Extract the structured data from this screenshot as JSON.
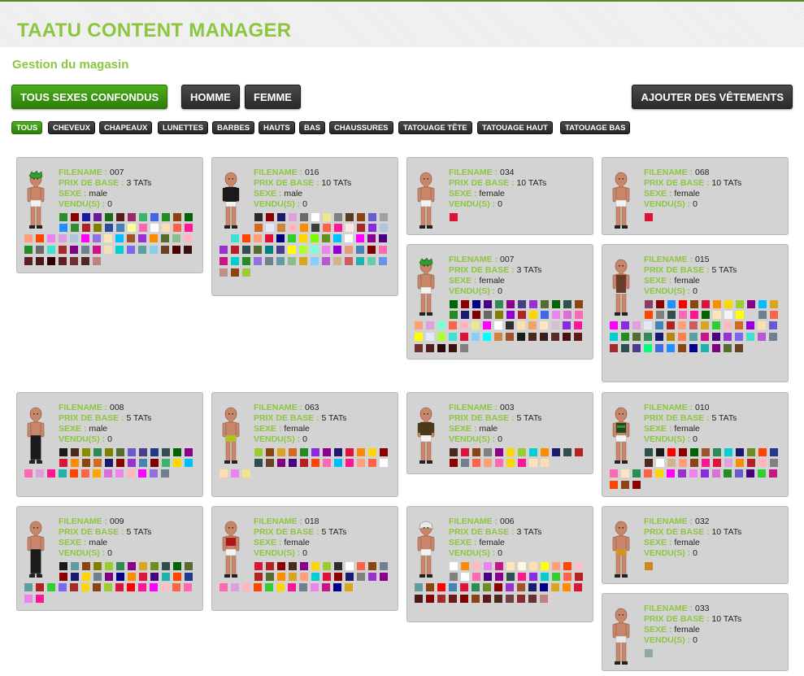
{
  "app_title": "TAATU CONTENT MANAGER",
  "page_subtitle": "Gestion du magasin",
  "gender_filters": [
    {
      "label": "TOUS SEXES CONFONDUS",
      "active": true
    },
    {
      "label": "HOMME",
      "active": false
    },
    {
      "label": "FEMME",
      "active": false
    }
  ],
  "add_button_label": "AJOUTER DES VÊTEMENTS",
  "category_filters": [
    {
      "label": "TOUS",
      "active": true
    },
    {
      "label": "CHEVEUX",
      "active": false
    },
    {
      "label": "CHAPEAUX",
      "active": false
    },
    {
      "label": "LUNETTES",
      "active": false
    },
    {
      "label": "BARBES",
      "active": false
    },
    {
      "label": "HAUTS",
      "active": false
    },
    {
      "label": "BAS",
      "active": false
    },
    {
      "label": "CHAUSSURES",
      "active": false
    },
    {
      "label": "TATOUAGE TÊTE",
      "active": false
    },
    {
      "label": "TATOUAGE HAUT",
      "active": false
    },
    {
      "label": "TATOUAGE BAS",
      "active": false
    }
  ],
  "field_labels": {
    "filename": "FILENAME :",
    "price": "PRIX DE BASE :",
    "sex": "SEXE :",
    "sold": "VENDU(S) :"
  },
  "items": [
    {
      "filename": "007",
      "price": "3 TATs",
      "sex": "male",
      "sold": "0",
      "outfit": "green-hair-shorts"
    },
    {
      "filename": "016",
      "price": "10 TATs",
      "sex": "male",
      "sold": "0",
      "outfit": "black-top"
    },
    {
      "filename": "034",
      "price": "10 TATs",
      "sex": "female",
      "sold": "0",
      "outfit": "plain"
    },
    {
      "filename": "068",
      "price": "10 TATs",
      "sex": "female",
      "sold": "0",
      "outfit": "plain"
    },
    {
      "filename": "007",
      "price": "3 TATs",
      "sex": "female",
      "sold": "0",
      "outfit": "green-hair"
    },
    {
      "filename": "015",
      "price": "5 TATs",
      "sex": "female",
      "sold": "0",
      "outfit": "dress"
    },
    {
      "filename": "008",
      "price": "5 TATs",
      "sex": "male",
      "sold": "0",
      "outfit": "black-pants"
    },
    {
      "filename": "063",
      "price": "5 TATs",
      "sex": "female",
      "sold": "0",
      "outfit": "yellow-bottom"
    },
    {
      "filename": "003",
      "price": "5 TATs",
      "sex": "male",
      "sold": "0",
      "outfit": "brown-top"
    },
    {
      "filename": "010",
      "price": "5 TATs",
      "sex": "female",
      "sold": "0",
      "outfit": "green-top"
    },
    {
      "filename": "009",
      "price": "5 TATs",
      "sex": "male",
      "sold": "0",
      "outfit": "black-pants"
    },
    {
      "filename": "018",
      "price": "5 TATs",
      "sex": "female",
      "sold": "0",
      "outfit": "red-top"
    },
    {
      "filename": "006",
      "price": "3 TATs",
      "sex": "female",
      "sold": "0",
      "outfit": "white-hair"
    },
    {
      "filename": "032",
      "price": "10 TATs",
      "sex": "female",
      "sold": "0",
      "outfit": "orange-bottom"
    },
    {
      "filename": "033",
      "price": "10 TATs",
      "sex": "female",
      "sold": "0",
      "outfit": "white-bottom"
    }
  ],
  "item_colors": [
    [
      "#2e8b2e",
      "#8b0000",
      "#1a1aa0",
      "#6a1a9a",
      "#1a6a1a",
      "#5a1a1a",
      "#9b2a6a",
      "#3cb371",
      "#4169e1",
      "#228b22",
      "#8b4513",
      "#006400",
      "#1e90ff",
      "#2f8f2f",
      "#b22222",
      "#808000",
      "#2e4a9a",
      "#4682b4",
      "#ffff99",
      "#ff69b4",
      "#ffffff",
      "#ffdead",
      "#ff6347",
      "#ff1493",
      "#ffa07a",
      "#ff4500",
      "#ee82ee",
      "#dda0dd",
      "#b0c4de",
      "#ff00ff",
      "#9370db",
      "#ffe4b5",
      "#00bfff",
      "#a0522d",
      "#9932cc",
      "#ff8c00",
      "#556b2f",
      "#8fbc8f",
      "#ffb6c1",
      "#228b22",
      "#696969",
      "#40e0d0",
      "#a52a2a",
      "#800080",
      "#708090",
      "#c71585",
      "#f5deb3",
      "#00ced1",
      "#7b68ee",
      "#5f9ea0",
      "#87ceeb",
      "#6b4226",
      "#4b0000",
      "#3b1010",
      "#5a2020",
      "#4a1a1a",
      "#2a0000",
      "#602020",
      "#703030",
      "#502828",
      "#c08080"
    ],
    [
      "#2a2a2a",
      "#8b0000",
      "#1c1c6e",
      "#dda0dd",
      "#696969",
      "#ffffff",
      "#f0e68c",
      "#808080",
      "#5a3a1a",
      "#8b4513",
      "#6a5acd",
      "#a0a0a0",
      "#d2691e",
      "#e6e6fa",
      "#cd853f",
      "#ffb6c1",
      "#ff8c00",
      "#3c3c3c",
      "#ff6347",
      "#ff1493",
      "#ffe4e1",
      "#a52a2a",
      "#8a2be2",
      "#b0c4de",
      "#d3d3d3",
      "#40e0d0",
      "#ff4500",
      "#ffa07a",
      "#dc143c",
      "#000080",
      "#32cd32",
      "#ffd700",
      "#7cfc00",
      "#6b8e23",
      "#00bfff",
      "#ffffff",
      "#ff00ff",
      "#8b008b",
      "#4b0082",
      "#9932cc",
      "#b22222",
      "#2f4f4f",
      "#556b2f",
      "#008080",
      "#483d8b",
      "#ffff00",
      "#adff2f",
      "#7fffd4",
      "#ee82ee",
      "#9400d3",
      "#e9967a",
      "#4682b4",
      "#800000",
      "#ff69b4",
      "#c71585",
      "#00ced1",
      "#228b22",
      "#9370db",
      "#708090",
      "#5f9ea0",
      "#8fbc8f",
      "#daa520",
      "#87cefa",
      "#ba55d3",
      "#d2b48c",
      "#cd5c5c",
      "#20b2aa",
      "#66cdaa",
      "#6495ed",
      "#bc8f8f",
      "#8b4513",
      "#9acd32"
    ],
    [
      "#dc143c"
    ],
    [
      "#dc143c"
    ],
    [
      "#006400",
      "#8b0000",
      "#00008b",
      "#4b0082",
      "#2e8b57",
      "#8b008b",
      "#483d8b",
      "#9932cc",
      "#556b2f",
      "#006400",
      "#2f4f4f",
      "#8b4513",
      "#228b22",
      "#191970",
      "#800000",
      "#696969",
      "#808000",
      "#9400d3",
      "#b22222",
      "#ffd700",
      "#4169e1",
      "#ee82ee",
      "#da70d6",
      "#ff69b4",
      "#ffa07a",
      "#dda0dd",
      "#7fffd4",
      "#ff6347",
      "#ffb6c1",
      "#f0e68c",
      "#ff00ff",
      "#ffffff",
      "#2e2e2e",
      "#ffdead",
      "#f4a460",
      "#ffe4c4",
      "#d8bfd8",
      "#8a2be2",
      "#ff1493",
      "#ffff00",
      "#e6e6fa",
      "#adff2f",
      "#40e0d0",
      "#dc143c",
      "#87cefa",
      "#00ffff",
      "#cd853f",
      "#a0522d",
      "#1c1c1c",
      "#4a2a1a",
      "#3a1a1a",
      "#5a2a2a",
      "#4a1010",
      "#601818",
      "#703030",
      "#502020",
      "#2a0a0a",
      "#401010",
      "#808080"
    ],
    [
      "#8b3a62",
      "#8b0000",
      "#1e90ff",
      "#ff0000",
      "#8b4513",
      "#dc143c",
      "#ff8c00",
      "#ffd700",
      "#9acd32",
      "#8b008b",
      "#00bfff",
      "#daa520",
      "#ff4500",
      "#808080",
      "#2f4f4f",
      "#ff69b4",
      "#ff1493",
      "#006400",
      "#ffe4b5",
      "#f5f5f5",
      "#ffff00",
      "#d3d3d3",
      "#708090",
      "#ff6347",
      "#ff00ff",
      "#8a2be2",
      "#dda0dd",
      "#e6e6fa",
      "#4682b4",
      "#b22222",
      "#ffa07a",
      "#cd5c5c",
      "#daa520",
      "#32cd32",
      "#ffb6c1",
      "#d2691e",
      "#9400d3",
      "#ffdead",
      "#6a5acd",
      "#00ced1",
      "#228b22",
      "#556b2f",
      "#2e8b57",
      "#191970",
      "#b8860b",
      "#ff7f50",
      "#5f9ea0",
      "#c71585",
      "#4b0082",
      "#9932cc",
      "#7b68ee",
      "#40e0d0",
      "#ba55d3",
      "#708090",
      "#a52a2a",
      "#2f4f4f",
      "#483d8b",
      "#00ff7f",
      "#4169e1",
      "#1e90ff",
      "#8b4513",
      "#00008b",
      "#20b2aa",
      "#800080",
      "#556b2f",
      "#6b4226"
    ],
    [
      "#1a1a1a",
      "#4a2a1a",
      "#8b8b00",
      "#2e8b57",
      "#808000",
      "#556b2f",
      "#6a5acd",
      "#483d8b",
      "#1e3a8a",
      "#2f4f4f",
      "#006400",
      "#8b008b",
      "#dc143c",
      "#ff8c00",
      "#8b4513",
      "#d2691e",
      "#1a1a6a",
      "#8b0000",
      "#9932cc",
      "#4682b4",
      "#800000",
      "#3cb371",
      "#ffd700",
      "#00bfff",
      "#ff69b4",
      "#dda0dd",
      "#ff1493",
      "#20b2aa",
      "#ff4500",
      "#ff6347",
      "#ffa500",
      "#da70d6",
      "#ee82ee",
      "#ffb6c1",
      "#ff00ff",
      "#9370db",
      "#708090"
    ],
    [
      "#9acd32",
      "#8b4513",
      "#daa520",
      "#d2691e",
      "#228b22",
      "#8a2be2",
      "#8b008b",
      "#1c1c6e",
      "#dc143c",
      "#ff8c00",
      "#ffd700",
      "#8b0000",
      "#2f4f4f",
      "#6b4226",
      "#800080",
      "#4b0082",
      "#b22222",
      "#ff4500",
      "#ff69b4",
      "#00bfff",
      "#ff1493",
      "#ffa07a",
      "#ff6347",
      "#ffffff",
      "#ffdead",
      "#ee82ee",
      "#f0e68c"
    ],
    [
      "#4a2a1a",
      "#dc143c",
      "#8b4513",
      "#808080",
      "#8b008b",
      "#ffd700",
      "#9acd32",
      "#00ced1",
      "#ff8c00",
      "#1a1a6e",
      "#2f4f4f",
      "#b22222",
      "#8b0000",
      "#708090",
      "#ff6347",
      "#ffa07a",
      "#ff69b4",
      "#ffd700",
      "#ff1493",
      "#ffe4b5",
      "#ffdead"
    ],
    [
      "#2f4f4f",
      "#1a1a1a",
      "#ff0000",
      "#8b0000",
      "#006400",
      "#a0522d",
      "#2e8b57",
      "#00ced1",
      "#191970",
      "#6b8e23",
      "#ff4500",
      "#1e3a8a",
      "#4a2a1a",
      "#ffffff",
      "#d2b48c",
      "#ffa07a",
      "#8b4513",
      "#ff1493",
      "#dc143c",
      "#dda0dd",
      "#ff8c00",
      "#b22222",
      "#ffb6c1",
      "#808080",
      "#ff69b4",
      "#ffe4c4",
      "#2e8b57",
      "#ff6347",
      "#ffd700",
      "#ff00ff",
      "#9932cc",
      "#ee82ee",
      "#8a2be2",
      "#da70d6",
      "#228b22",
      "#6a5acd",
      "#4b0082",
      "#32cd32",
      "#c71585",
      "#ff4500",
      "#8b4513",
      "#8b0000"
    ],
    [
      "#1a1a1a",
      "#5f9ea0",
      "#8b4513",
      "#808000",
      "#9acd32",
      "#2e8b57",
      "#8b008b",
      "#daa520",
      "#6b8e23",
      "#2f4f4f",
      "#006400",
      "#556b2f",
      "#8b0000",
      "#1a1a6e",
      "#ffd700",
      "#708090",
      "#800080",
      "#00008b",
      "#ff8c00",
      "#dc143c",
      "#4b0082",
      "#20b2aa",
      "#ff4500",
      "#1e3a8a",
      "#5f9ea0",
      "#b22222",
      "#32cd32",
      "#7b68ee",
      "#a52a2a",
      "#ffd700",
      "#8b4513",
      "#9acd32",
      "#dc143c",
      "#ff0000",
      "#ff1493",
      "#ff00ff",
      "#ffc0cb",
      "#ff6347",
      "#ff69b4",
      "#ee82ee",
      "#ff1493"
    ],
    [
      "#dc143c",
      "#b22222",
      "#8b0000",
      "#4a2a1a",
      "#8b008b",
      "#ffd700",
      "#9acd32",
      "#2f2f2f",
      "#ffffff",
      "#ff6347",
      "#8b4513",
      "#708090",
      "#b22222",
      "#556b2f",
      "#ff8c00",
      "#daa520",
      "#ffa07a",
      "#00ced1",
      "#dc143c",
      "#8b0000",
      "#1a1a6e",
      "#808080",
      "#9932cc",
      "#8b008b",
      "#ff69b4",
      "#dda0dd",
      "#ffb6c1",
      "#ff4500",
      "#32cd32",
      "#ffd700",
      "#ff1493",
      "#708090",
      "#ee82ee",
      "#c71585",
      "#00008b",
      "#daa520"
    ],
    [
      "#ffffff",
      "#ff8c00",
      "#ffb6c1",
      "#ee82ee",
      "#c71585",
      "#ffe4b5",
      "#fff8dc",
      "#ffdead",
      "#ffff00",
      "#ffa07a",
      "#ff4500",
      "#ffc0cb",
      "#808080",
      "#ffffff",
      "#ff69b4",
      "#4b0082",
      "#8b008b",
      "#2f4f4f",
      "#ff1493",
      "#8a2be2",
      "#00ced1",
      "#32cd32",
      "#ff6347",
      "#b22222",
      "#5f9ea0",
      "#8b4513",
      "#ff0000",
      "#4682b4",
      "#dc143c",
      "#2e8b57",
      "#6b8e23",
      "#8b0000",
      "#9932cc",
      "#a0522d",
      "#1a1a6e",
      "#00008b",
      "#daa520",
      "#ff8c00",
      "#dc143c",
      "#4a1a1a",
      "#8b0000",
      "#a52a2a",
      "#6b1a1a",
      "#800000",
      "#8b4513",
      "#5a1a1a",
      "#4a2a1a",
      "#704040",
      "#8b2a2a",
      "#6a3030",
      "#c08080"
    ],
    [
      "#cd8a1a"
    ],
    [
      "#8fa8a8"
    ]
  ]
}
